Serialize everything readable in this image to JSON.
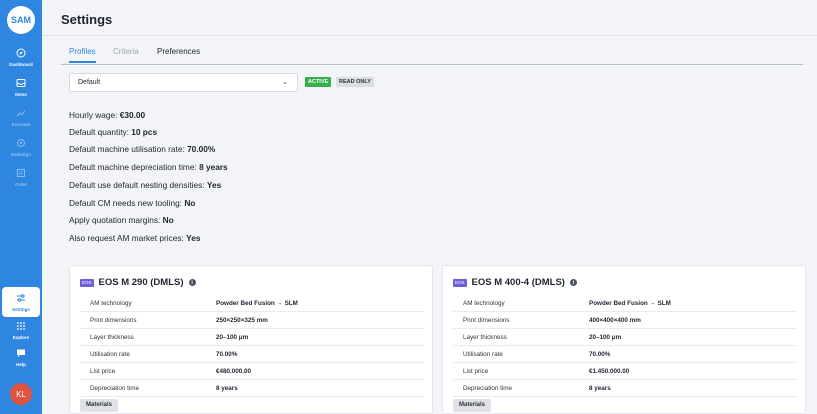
{
  "app": {
    "logo_text": "SAM"
  },
  "sidebar": {
    "items": [
      {
        "label": "Dashboard",
        "icon": "compass-icon",
        "state": "normal"
      },
      {
        "label": "Items",
        "icon": "inbox-icon",
        "state": "normal"
      },
      {
        "label": "Estimate",
        "icon": "trend-icon",
        "state": "dim"
      },
      {
        "label": "Redesign",
        "icon": "cog-icon",
        "state": "dim"
      },
      {
        "label": "Order",
        "icon": "cart-icon",
        "state": "dim"
      }
    ],
    "bottom_items": [
      {
        "label": "Settings",
        "icon": "sliders-icon",
        "state": "active"
      },
      {
        "label": "Explore",
        "icon": "grid-icon",
        "state": "normal"
      },
      {
        "label": "Help",
        "icon": "chat-icon",
        "state": "normal"
      }
    ],
    "avatar_initials": "KL"
  },
  "header": {
    "title": "Settings"
  },
  "tabs": [
    {
      "label": "Profiles",
      "active": true
    },
    {
      "label": "Criteria",
      "active": false
    },
    {
      "label": "Preferences",
      "active": false
    }
  ],
  "profile": {
    "selected": "Default",
    "badge_active": "ACTIVE",
    "badge_readonly": "READ ONLY"
  },
  "settings": [
    {
      "label": "Hourly wage: ",
      "value": "€30.00"
    },
    {
      "label": "Default quantity: ",
      "value": "10 pcs"
    },
    {
      "label": "Default machine utilisation rate: ",
      "value": "70.00%"
    },
    {
      "label": "Default machine depreciation time: ",
      "value": "8 years"
    },
    {
      "label": "Default use default nesting densities: ",
      "value": "Yes"
    },
    {
      "label": "Default CM needs new tooling: ",
      "value": "No"
    },
    {
      "label": "Apply quotation margins: ",
      "value": "No"
    },
    {
      "label": "Also request AM market prices: ",
      "value": "Yes"
    }
  ],
  "machines": [
    {
      "tag": "EOS",
      "name": "EOS M 290 (DMLS)",
      "rows": [
        {
          "key": "AM technology",
          "value": "Powder Bed Fusion → SLM"
        },
        {
          "key": "Print dimensions",
          "value": "250×250×325 mm"
        },
        {
          "key": "Layer thickness",
          "value": "20–100 μm"
        },
        {
          "key": "Utilisation rate",
          "value": "70.00%"
        },
        {
          "key": "List price",
          "value": "€480.000.00"
        },
        {
          "key": "Depreciation time",
          "value": "8 years"
        }
      ],
      "materials_label": "Materials"
    },
    {
      "tag": "EOS",
      "name": "EOS M 400-4 (DMLS)",
      "rows": [
        {
          "key": "AM technology",
          "value": "Powder Bed Fusion → SLM"
        },
        {
          "key": "Print dimensions",
          "value": "400×400×400 mm"
        },
        {
          "key": "Layer thickness",
          "value": "20–100 μm"
        },
        {
          "key": "Utilisation rate",
          "value": "70.00%"
        },
        {
          "key": "List price",
          "value": "€1.450.000.00"
        },
        {
          "key": "Depreciation time",
          "value": "8 years"
        }
      ],
      "materials_label": "Materials"
    }
  ],
  "colors": {
    "sidebar": "#2f86e0",
    "active_badge": "#36b24a",
    "eos_tag": "#6a5fd6",
    "avatar": "#e0533f"
  }
}
